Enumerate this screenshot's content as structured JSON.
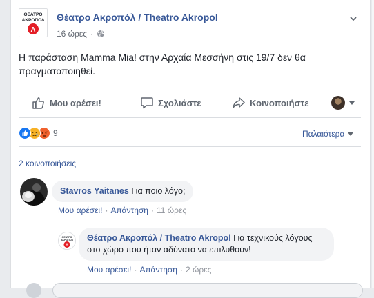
{
  "post": {
    "page_name": "Θέατρο Ακροπόλ / Theatro Akropol",
    "time": "16 ώρες",
    "text": "Η παράσταση Mamma Mia! στην Αρχαία Μεσσήνη στις 19/7 δεν θα πραγματοποιηθεί.",
    "logo_text_top": "ΘΕΑΤΡΟ",
    "logo_text_bottom": "ΑΚΡΟΠΟΛ",
    "logo_mark": "Λ"
  },
  "actions": {
    "like": "Μου αρέσει!",
    "comment": "Σχολιάστε",
    "share": "Κοινοποιήστε"
  },
  "reactions": {
    "count": "9",
    "sort_label": "Παλαιότερα"
  },
  "shares_label": "2 κοινοποιήσεις",
  "comments": [
    {
      "author": "Stavros Yaitanes",
      "text": " Για ποιο λόγο;",
      "like": "Μου αρέσει!",
      "reply": "Απάντηση",
      "time": "11 ώρες"
    },
    {
      "author": "Θέατρο Ακροπόλ / Theatro Akropol",
      "text": " Για τεχνικούς λόγους στο χώρο που ήταν αδύνατο να επιλυθούν!",
      "like": "Μου αρέσει!",
      "reply": "Απάντηση",
      "time": "2 ώρες"
    }
  ],
  "colors": {
    "link": "#385898",
    "secondary": "#606770",
    "brand_red": "#e41e26",
    "like_blue": "#1877f2",
    "angry_orange": "#f0612d",
    "sad_yellow": "#f7b125"
  },
  "icons": {
    "globe": "globe-icon",
    "chevron": "chevron-down-icon",
    "like": "thumbs-up-icon",
    "comment": "comment-icon",
    "share": "share-icon"
  }
}
